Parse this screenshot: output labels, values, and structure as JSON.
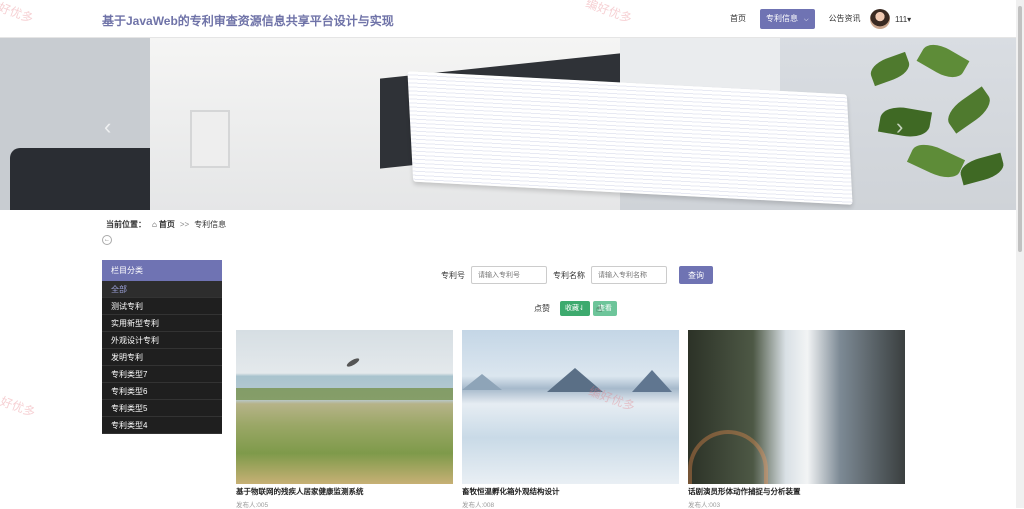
{
  "header": {
    "site_title": "基于JavaWeb的专利审查资源信息共享平台设计与实现",
    "nav": [
      {
        "label": "首页"
      },
      {
        "label": "专利信息"
      },
      {
        "label": "公告资讯"
      }
    ],
    "user": {
      "name": "111▾"
    }
  },
  "banner": {
    "prev_icon": "chevron-left-icon",
    "next_icon": "chevron-right-icon"
  },
  "breadcrumb": {
    "prefix": "当前位置：",
    "home_icon": "home-icon",
    "home": "首页",
    "separator": ">>",
    "current": "专利信息"
  },
  "sidebar": {
    "title": "栏目分类",
    "items": [
      {
        "label": "全部"
      },
      {
        "label": "测试专利"
      },
      {
        "label": "实用新型专利"
      },
      {
        "label": "外观设计专利"
      },
      {
        "label": "发明专利"
      },
      {
        "label": "专利类型7"
      },
      {
        "label": "专利类型6"
      },
      {
        "label": "专利类型5"
      },
      {
        "label": "专利类型4"
      }
    ]
  },
  "search": {
    "patent_no_label": "专利号",
    "patent_no_placeholder": "请输入专利号",
    "patent_name_label": "专利名称",
    "patent_name_placeholder": "请输入专利名称",
    "button": "查询"
  },
  "sort": {
    "label": "点赞",
    "buttons": [
      {
        "label": "收藏⇃"
      },
      {
        "label": "查看"
      }
    ]
  },
  "cards": [
    {
      "title": "基于物联网的残疾人居家健康监测系统",
      "author": "发布人:005"
    },
    {
      "title": "畜牧恒温孵化箱外观结构设计",
      "author": "发布人:008"
    },
    {
      "title": "话剧演员形体动作捕捉与分析装置",
      "author": "发布人:003"
    }
  ],
  "watermarks": [
    "好优多",
    "编好优多",
    "编好优多",
    "好优多"
  ]
}
